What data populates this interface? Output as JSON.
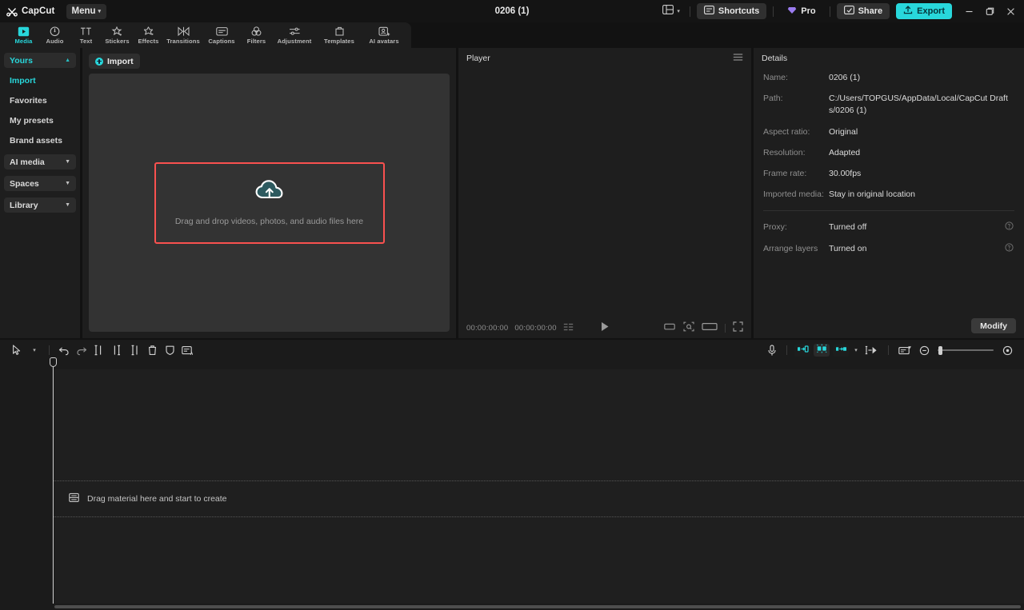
{
  "titlebar": {
    "brand": "CapCut",
    "menu_label": "Menu",
    "document_title": "0206 (1)",
    "layout_icon": "layout-icon",
    "shortcuts_label": "Shortcuts",
    "pro_label": "Pro",
    "share_label": "Share",
    "export_label": "Export",
    "minimize_icon": "minimize-icon",
    "maximize_icon": "restore-icon",
    "close_icon": "close-icon",
    "accent": "#28d7db"
  },
  "tabs": [
    {
      "label": "Media",
      "icon": "media-icon",
      "active": true
    },
    {
      "label": "Audio",
      "icon": "audio-icon",
      "active": false
    },
    {
      "label": "Text",
      "icon": "text-icon",
      "active": false
    },
    {
      "label": "Stickers",
      "icon": "sticker-icon",
      "active": false
    },
    {
      "label": "Effects",
      "icon": "effects-icon",
      "active": false
    },
    {
      "label": "Transitions",
      "icon": "transitions-icon",
      "active": false
    },
    {
      "label": "Captions",
      "icon": "captions-icon",
      "active": false
    },
    {
      "label": "Filters",
      "icon": "filters-icon",
      "active": false
    },
    {
      "label": "Adjustment",
      "icon": "adjustment-icon",
      "active": false
    },
    {
      "label": "Templates",
      "icon": "templates-icon",
      "active": false
    },
    {
      "label": "AI avatars",
      "icon": "ai-avatars-icon",
      "active": false
    }
  ],
  "sidebar": {
    "groups": [
      {
        "label": "Yours",
        "type": "group",
        "expanded": true,
        "caret": "▲",
        "active": true
      },
      {
        "label": "Import",
        "type": "item",
        "active": true
      },
      {
        "label": "Favorites",
        "type": "item",
        "active": false
      },
      {
        "label": "My presets",
        "type": "item",
        "active": false
      },
      {
        "label": "Brand assets",
        "type": "item",
        "active": false
      },
      {
        "label": "AI media",
        "type": "group",
        "expanded": false,
        "caret": "▼",
        "active": false
      },
      {
        "label": "Spaces",
        "type": "group",
        "expanded": false,
        "caret": "▼",
        "active": false
      },
      {
        "label": "Library",
        "type": "group",
        "expanded": false,
        "caret": "▼",
        "active": false
      }
    ]
  },
  "media": {
    "import_label": "Import",
    "dropzone_text": "Drag and drop videos, photos, and audio files here",
    "dropzone_highlight_color": "#f9514f",
    "cloud_icon": "cloud-upload-icon"
  },
  "player": {
    "title": "Player",
    "menu_icon": "hamburger-icon",
    "current_time": "00:00:00:00",
    "total_time": "00:00:00:00",
    "list_icon": "playlist-icon",
    "play_icon": "play-icon",
    "ratio_icon": "aspect-ratio-icon",
    "crop_icon": "crop-icon",
    "wide_icon": "widescreen-icon",
    "fullscreen_icon": "fullscreen-icon"
  },
  "details": {
    "title": "Details",
    "rows": [
      {
        "key": "Name:",
        "value": "0206 (1)",
        "help": false
      },
      {
        "key": "Path:",
        "value": "C:/Users/TOPGUS/AppData/Local/CapCut Drafts/0206 (1)",
        "help": false
      },
      {
        "key": "Aspect ratio:",
        "value": "Original",
        "help": false
      },
      {
        "key": "Resolution:",
        "value": "Adapted",
        "help": false
      },
      {
        "key": "Frame rate:",
        "value": "30.00fps",
        "help": false
      },
      {
        "key": "Imported media:",
        "value": "Stay in original location",
        "help": false
      }
    ],
    "rows2": [
      {
        "key": "Proxy:",
        "value": "Turned off",
        "help": true
      },
      {
        "key": "Arrange layers",
        "value": "Turned on",
        "help": true
      }
    ],
    "modify_label": "Modify",
    "help_icon": "help-icon"
  },
  "timeline": {
    "tools_left": [
      {
        "icon": "select-arrow-icon",
        "name": "select-tool"
      },
      {
        "icon": "chevron-down-icon",
        "name": "select-tool-dropdown"
      },
      {
        "icon": "undo-icon",
        "name": "undo"
      },
      {
        "icon": "redo-icon",
        "name": "redo"
      },
      {
        "icon": "split-icon",
        "name": "split"
      },
      {
        "icon": "trim-left-icon",
        "name": "trim-left"
      },
      {
        "icon": "trim-right-icon",
        "name": "trim-right"
      },
      {
        "icon": "delete-icon",
        "name": "delete"
      },
      {
        "icon": "mirror-icon",
        "name": "mirror"
      },
      {
        "icon": "auto-caption-icon",
        "name": "auto-caption"
      }
    ],
    "tools_right": [
      {
        "icon": "microphone-icon",
        "name": "record-voiceover"
      },
      {
        "icon": "auto-cut-start-icon",
        "name": "auto-cut-start"
      },
      {
        "icon": "smart-trim-icon",
        "name": "smart-trim"
      },
      {
        "icon": "auto-cut-end-icon",
        "name": "auto-cut-end"
      },
      {
        "icon": "chevron-down-icon",
        "name": "auto-cut-dropdown"
      },
      {
        "icon": "link-cut-icon",
        "name": "link-cut"
      },
      {
        "icon": "keyframe-panel-icon",
        "name": "keyframe-panel"
      },
      {
        "icon": "zoom-out-icon",
        "name": "zoom-out"
      },
      {
        "icon": "zoom-in-icon",
        "name": "zoom-in"
      }
    ],
    "drop_track_text": "Drag material here and start to create",
    "drop_track_icon": "track-icon",
    "zoom_value": 4
  }
}
